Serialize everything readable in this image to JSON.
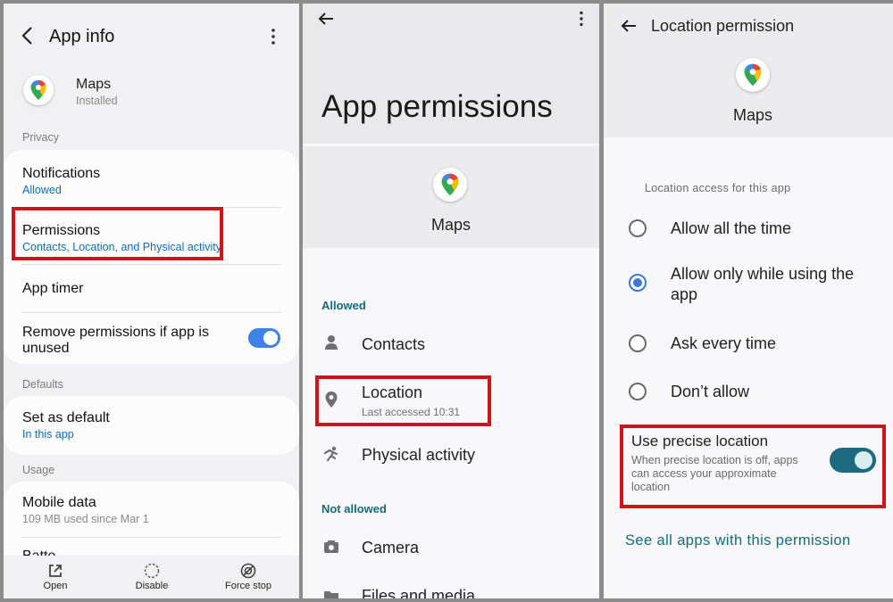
{
  "panel1": {
    "title": "App info",
    "app_name": "Maps",
    "app_status": "Installed",
    "sections": {
      "privacy": "Privacy",
      "defaults": "Defaults",
      "usage": "Usage"
    },
    "notifications": {
      "label": "Notifications",
      "value": "Allowed"
    },
    "permissions": {
      "label": "Permissions",
      "value": "Contacts, Location, and Physical activity"
    },
    "app_timer": "App timer",
    "remove_permissions": {
      "label_line1": "Remove permissions if app is",
      "label_line2": "unused",
      "enabled": true
    },
    "set_as_default": {
      "label": "Set as default",
      "value": "In this app"
    },
    "mobile_data": {
      "label": "Mobile data",
      "value": "109 MB used since Mar 1"
    },
    "battery_partial": "Batte",
    "bottom_actions": [
      {
        "label": "Open",
        "icon": "open-external-icon"
      },
      {
        "label": "Disable",
        "icon": "disable-circle-icon"
      },
      {
        "label": "Force stop",
        "icon": "force-stop-icon"
      }
    ]
  },
  "panel2": {
    "title": "App permissions",
    "app_name": "Maps",
    "allowed_header": "Allowed",
    "allowed": [
      {
        "label": "Contacts",
        "icon": "person-icon"
      },
      {
        "label": "Location",
        "sub": "Last accessed 10:31",
        "icon": "location-pin-icon"
      },
      {
        "label": "Physical activity",
        "icon": "running-icon"
      }
    ],
    "not_allowed_header": "Not allowed",
    "not_allowed": [
      {
        "label": "Camera",
        "icon": "camera-icon"
      },
      {
        "label": "Files and media",
        "icon": "folder-icon"
      }
    ]
  },
  "panel3": {
    "title": "Location permission",
    "app_name": "Maps",
    "section_label": "Location access for this app",
    "options": [
      {
        "label": "Allow all the time",
        "selected": false
      },
      {
        "label_line1": "Allow only while using the",
        "label_line2": "app",
        "selected": true
      },
      {
        "label": "Ask every time",
        "selected": false
      },
      {
        "label": "Don’t allow",
        "selected": false
      }
    ],
    "precise": {
      "label": "Use precise location",
      "desc_line1": "When precise location is off, apps",
      "desc_line2": "can access your approximate",
      "desc_line3": "location",
      "enabled": true
    },
    "see_all": "See all apps with this permission"
  },
  "colors": {
    "highlight_red": "#d1141b",
    "link_blue": "#0a6ec9",
    "teal": "#136b7f",
    "toggle_blue": "#3d82e4"
  }
}
